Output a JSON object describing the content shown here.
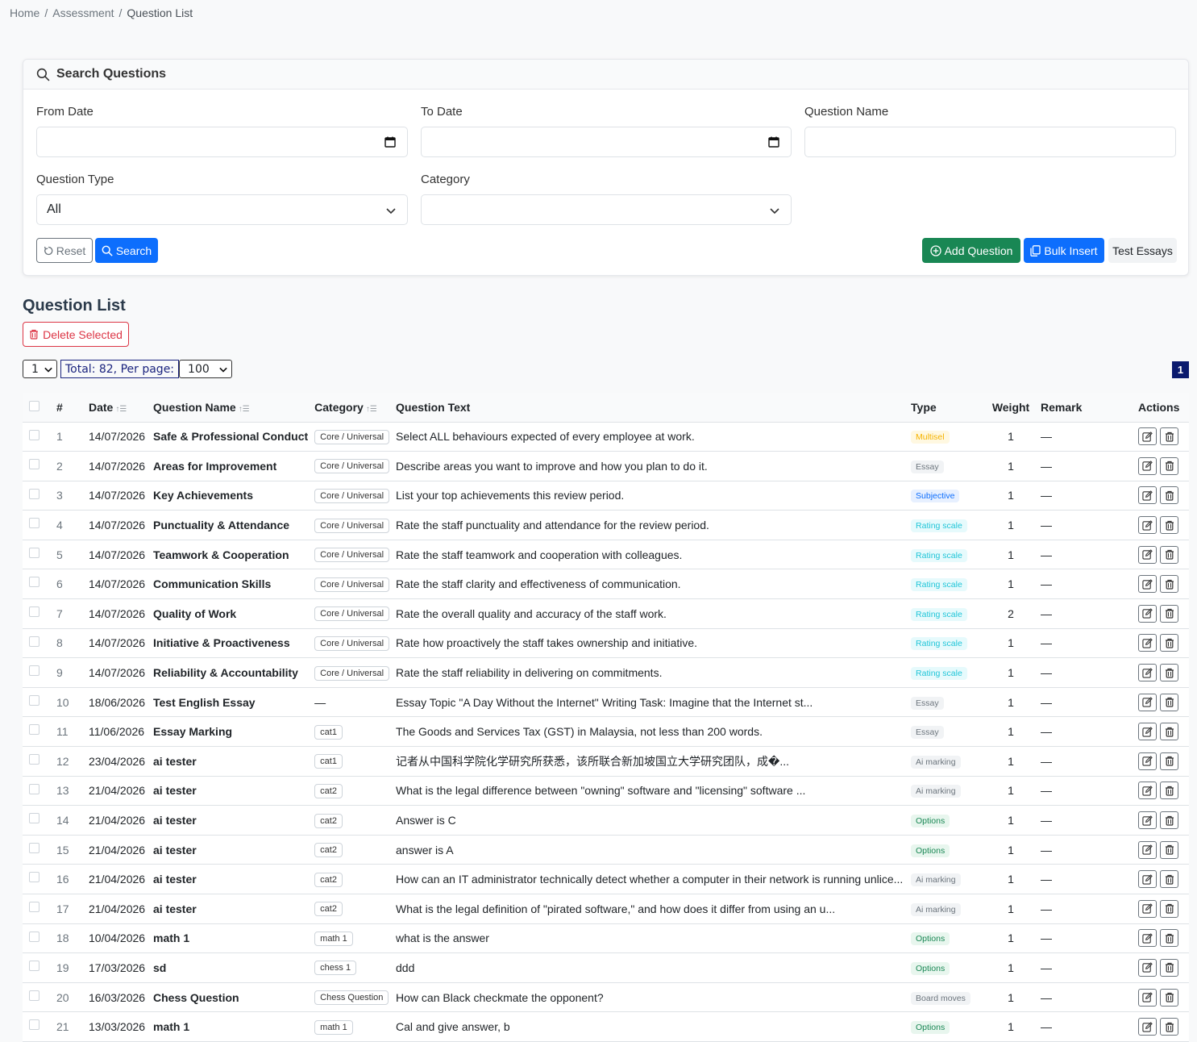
{
  "breadcrumb": {
    "home": "Home",
    "assessment": "Assessment",
    "current": "Question List"
  },
  "search": {
    "title": "Search Questions",
    "from_date_label": "From Date",
    "to_date_label": "To Date",
    "question_name_label": "Question Name",
    "question_type_label": "Question Type",
    "question_type_value": "All",
    "category_label": "Category",
    "category_value": "",
    "reset_label": "Reset",
    "search_label": "Search",
    "add_question_label": "Add Question",
    "bulk_insert_label": "Bulk Insert",
    "test_essays_label": "Test Essays"
  },
  "list": {
    "title": "Question List",
    "delete_selected_label": "Delete Selected",
    "page_select_value": "1",
    "total_label": "Total: 82, Per page:",
    "per_page_value": "100",
    "current_page": "1",
    "headers": [
      "#",
      "Date",
      "Question Name",
      "Category",
      "Question Text",
      "Type",
      "Weight",
      "Remark",
      "Actions"
    ],
    "rows": [
      {
        "n": "1",
        "date": "14/07/2026",
        "name": "Safe & Professional Conduct",
        "cat": "Core / Universal",
        "text": "Select ALL behaviours expected of every employee at work.",
        "type": "Multisel",
        "tclass": "t-multisel",
        "weight": "1",
        "remark": "—"
      },
      {
        "n": "2",
        "date": "14/07/2026",
        "name": "Areas for Improvement",
        "cat": "Core / Universal",
        "text": "Describe areas you want to improve and how you plan to do it.",
        "type": "Essay",
        "tclass": "t-essay",
        "weight": "1",
        "remark": "—"
      },
      {
        "n": "3",
        "date": "14/07/2026",
        "name": "Key Achievements",
        "cat": "Core / Universal",
        "text": "List your top achievements this review period.",
        "type": "Subjective",
        "tclass": "t-subjective",
        "weight": "1",
        "remark": "—"
      },
      {
        "n": "4",
        "date": "14/07/2026",
        "name": "Punctuality & Attendance",
        "cat": "Core / Universal",
        "text": "Rate the staff punctuality and attendance for the review period.",
        "type": "Rating scale",
        "tclass": "t-rating",
        "weight": "1",
        "remark": "—"
      },
      {
        "n": "5",
        "date": "14/07/2026",
        "name": "Teamwork & Cooperation",
        "cat": "Core / Universal",
        "text": "Rate the staff teamwork and cooperation with colleagues.",
        "type": "Rating scale",
        "tclass": "t-rating",
        "weight": "1",
        "remark": "—"
      },
      {
        "n": "6",
        "date": "14/07/2026",
        "name": "Communication Skills",
        "cat": "Core / Universal",
        "text": "Rate the staff clarity and effectiveness of communication.",
        "type": "Rating scale",
        "tclass": "t-rating",
        "weight": "1",
        "remark": "—"
      },
      {
        "n": "7",
        "date": "14/07/2026",
        "name": "Quality of Work",
        "cat": "Core / Universal",
        "text": "Rate the overall quality and accuracy of the staff work.",
        "type": "Rating scale",
        "tclass": "t-rating",
        "weight": "2",
        "remark": "—"
      },
      {
        "n": "8",
        "date": "14/07/2026",
        "name": "Initiative & Proactiveness",
        "cat": "Core / Universal",
        "text": "Rate how proactively the staff takes ownership and initiative.",
        "type": "Rating scale",
        "tclass": "t-rating",
        "weight": "1",
        "remark": "—"
      },
      {
        "n": "9",
        "date": "14/07/2026",
        "name": "Reliability & Accountability",
        "cat": "Core / Universal",
        "text": "Rate the staff reliability in delivering on commitments.",
        "type": "Rating scale",
        "tclass": "t-rating",
        "weight": "1",
        "remark": "—"
      },
      {
        "n": "10",
        "date": "18/06/2026",
        "name": "Test English Essay",
        "cat": "",
        "text": "Essay Topic \"A Day Without the Internet\" Writing Task: Imagine that the Internet st...",
        "type": "Essay",
        "tclass": "t-essay",
        "weight": "1",
        "remark": "—"
      },
      {
        "n": "11",
        "date": "11/06/2026",
        "name": "Essay Marking",
        "cat": "cat1",
        "text": "The Goods and Services Tax (GST) in Malaysia, not less than 200 words.",
        "type": "Essay",
        "tclass": "t-essay",
        "weight": "1",
        "remark": "—"
      },
      {
        "n": "12",
        "date": "23/04/2026",
        "name": "ai tester",
        "cat": "cat1",
        "text": "记者从中国科学院化学研究所获悉，该所联合新加坡国立大学研究团队，成�...",
        "type": "Ai marking",
        "tclass": "t-ai",
        "weight": "1",
        "remark": "—"
      },
      {
        "n": "13",
        "date": "21/04/2026",
        "name": "ai tester",
        "cat": "cat2",
        "text": "What is the legal difference between \"owning\" software and \"licensing\" software ...",
        "type": "Ai marking",
        "tclass": "t-ai",
        "weight": "1",
        "remark": "—"
      },
      {
        "n": "14",
        "date": "21/04/2026",
        "name": "ai tester",
        "cat": "cat2",
        "text": "Answer is C",
        "type": "Options",
        "tclass": "t-options",
        "weight": "1",
        "remark": "—"
      },
      {
        "n": "15",
        "date": "21/04/2026",
        "name": "ai tester",
        "cat": "cat2",
        "text": "answer is A",
        "type": "Options",
        "tclass": "t-options",
        "weight": "1",
        "remark": "—"
      },
      {
        "n": "16",
        "date": "21/04/2026",
        "name": "ai tester",
        "cat": "cat2",
        "text": "How can an IT administrator technically detect whether a computer in their network is running unlice...",
        "type": "Ai marking",
        "tclass": "t-ai",
        "weight": "1",
        "remark": "—"
      },
      {
        "n": "17",
        "date": "21/04/2026",
        "name": "ai tester",
        "cat": "cat2",
        "text": "What is the legal definition of \"pirated software,\" and how does it differ from using an u...",
        "type": "Ai marking",
        "tclass": "t-ai",
        "weight": "1",
        "remark": "—"
      },
      {
        "n": "18",
        "date": "10/04/2026",
        "name": "math 1",
        "cat": "math 1",
        "text": "what is the answer",
        "type": "Options",
        "tclass": "t-options",
        "weight": "1",
        "remark": "—"
      },
      {
        "n": "19",
        "date": "17/03/2026",
        "name": "sd",
        "cat": "chess 1",
        "text": "ddd",
        "type": "Options",
        "tclass": "t-options",
        "weight": "1",
        "remark": "—"
      },
      {
        "n": "20",
        "date": "16/03/2026",
        "name": "Chess Question",
        "cat": "Chess Question",
        "text": "How can Black checkmate the opponent?",
        "type": "Board moves",
        "tclass": "t-board",
        "weight": "1",
        "remark": "—"
      },
      {
        "n": "21",
        "date": "13/03/2026",
        "name": "math 1",
        "cat": "math 1",
        "text": "Cal and give answer, b",
        "type": "Options",
        "tclass": "t-options",
        "weight": "1",
        "remark": "—"
      }
    ]
  },
  "icons": {
    "search": "search-icon",
    "calendar": "calendar-icon",
    "chevron": "chevron-down-icon",
    "edit": "edit-icon",
    "trash": "trash-icon",
    "reset": "reset-icon",
    "add": "plus-circle-icon",
    "copy": "copy-icon",
    "sort": "sort-icon"
  }
}
